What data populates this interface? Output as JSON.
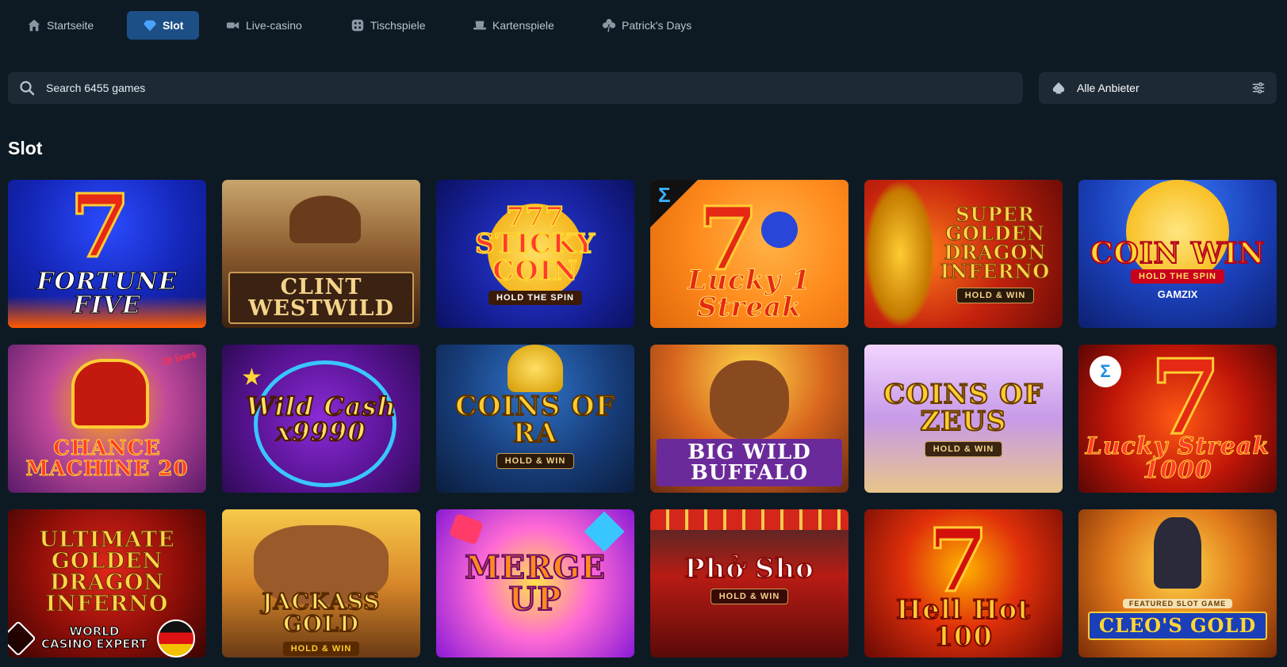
{
  "nav": {
    "items": [
      {
        "label": "Startseite",
        "icon": "home-icon"
      },
      {
        "label": "Slot",
        "icon": "diamond-icon",
        "active": true
      },
      {
        "label": "Live-casino",
        "icon": "camera-icon"
      },
      {
        "label": "Tischspiele",
        "icon": "dice-icon"
      },
      {
        "label": "Kartenspiele",
        "icon": "card-hat-icon"
      },
      {
        "label": "Patrick's Days",
        "icon": "clover-icon"
      }
    ]
  },
  "search": {
    "placeholder": "Search 6455 games",
    "icon": "search-icon"
  },
  "provider_filter": {
    "label": "Alle Anbieter",
    "icon": "spade-icon",
    "settings_icon": "sliders-icon"
  },
  "section_title": "Slot",
  "games": [
    {
      "title": "Fortune Five",
      "sub": ""
    },
    {
      "title": "Clint Westwild",
      "sub": ""
    },
    {
      "title": "777 Sticky Coin",
      "sub": "HOLD THE SPIN"
    },
    {
      "title": "Lucky 1 Streak",
      "sub": ""
    },
    {
      "title": "Super Golden Dragon Inferno",
      "sub": "HOLD & WIN"
    },
    {
      "title": "Coin Win",
      "sub": "HOLD THE SPIN",
      "extra": "GAMZIX"
    },
    {
      "title": "Chance machine 20",
      "sub": "20 lines"
    },
    {
      "title": "Wild Cash x9990",
      "sub": ""
    },
    {
      "title": "Coins of Ra",
      "sub": "HOLD & WIN"
    },
    {
      "title": "Big Wild Buffalo",
      "sub": ""
    },
    {
      "title": "Coins of Zeus",
      "sub": "HOLD & WIN"
    },
    {
      "title": "Lucky Streak 1000",
      "sub": ""
    },
    {
      "title": "Ultimate Golden Dragon Inferno",
      "sub": ""
    },
    {
      "title": "Jackass Gold",
      "sub": "HOLD & WIN"
    },
    {
      "title": "Merge Up",
      "sub": ""
    },
    {
      "title": "Phở Sho",
      "sub": "HOLD & WIN"
    },
    {
      "title": "Hell Hot 100",
      "sub": ""
    },
    {
      "title": "Cleo's Gold",
      "sub": "FEATURED SLOT GAME"
    }
  ],
  "watermark": {
    "line1": "WORLD",
    "line2": "CASINO EXPERT"
  },
  "colors": {
    "background": "#0d1a24",
    "active_tab": "#1c4f86",
    "input_bg": "#1d2a36"
  }
}
